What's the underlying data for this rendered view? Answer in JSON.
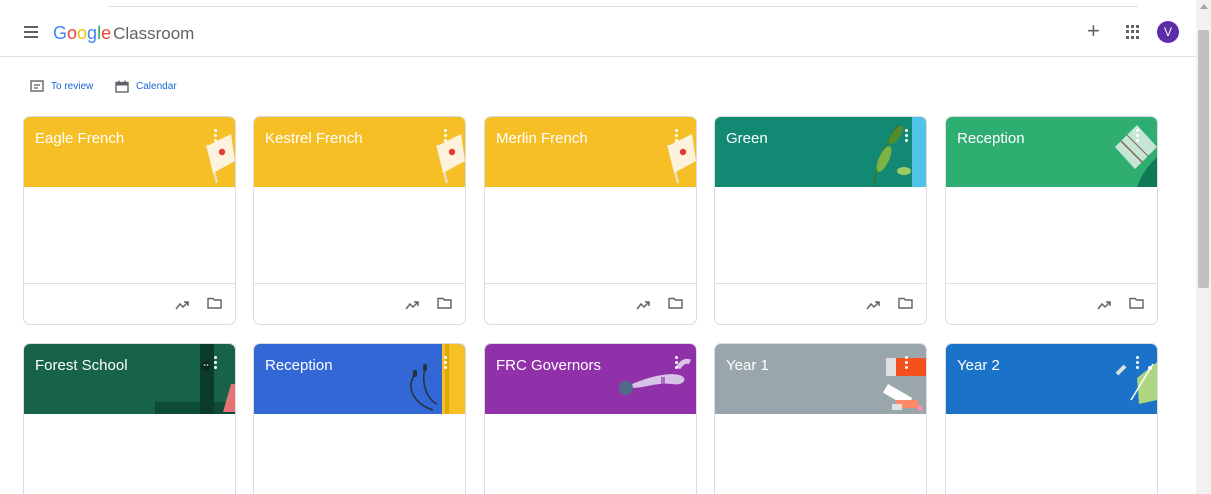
{
  "appbar": {
    "logo_letters": [
      "G",
      "o",
      "o",
      "g",
      "l",
      "e"
    ],
    "product": "Classroom",
    "avatar_letter": "V",
    "plus_glyph": "+"
  },
  "toolbar": {
    "to_review": "To review",
    "calendar": "Calendar"
  },
  "classes": [
    {
      "name": "Eagle French",
      "color": "#f6bf26",
      "art": "flag"
    },
    {
      "name": "Kestrel French",
      "color": "#f6bf26",
      "art": "flag"
    },
    {
      "name": "Merlin French",
      "color": "#f6bf26",
      "art": "flag"
    },
    {
      "name": "Green",
      "color": "#128a73",
      "art": "leaves"
    },
    {
      "name": "Reception",
      "color": "#2fae72",
      "art": "diamond"
    },
    {
      "name": "Forest School",
      "color": "#17624a",
      "art": "door"
    },
    {
      "name": "Reception",
      "color": "#3367d6",
      "art": "earphones"
    },
    {
      "name": "FRC Governors",
      "color": "#9031aa",
      "art": "bowling"
    },
    {
      "name": "Year 1",
      "color": "#99a6ac",
      "art": "paint"
    },
    {
      "name": "Year 2",
      "color": "#1a73c8",
      "art": "geometry"
    }
  ]
}
